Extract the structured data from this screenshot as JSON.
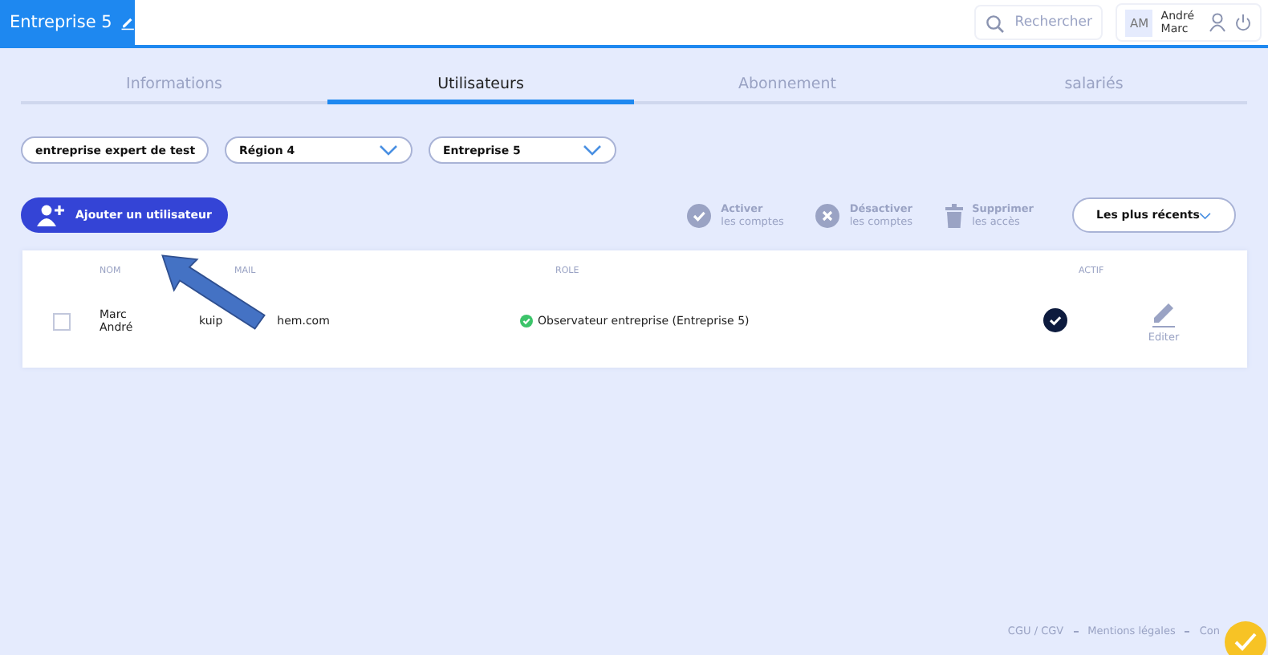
{
  "header": {
    "title": "Entreprise 5",
    "search": {
      "placeholder": "Rechercher"
    },
    "user": {
      "initials": "AM",
      "first_name": "André",
      "last_name": "Marc"
    }
  },
  "tabs": [
    {
      "label": "Informations",
      "selected": false
    },
    {
      "label": "Utilisateurs",
      "selected": true
    },
    {
      "label": "Abonnement",
      "selected": false
    },
    {
      "label": "salariés",
      "selected": false
    }
  ],
  "filters": [
    "entreprise expert de test",
    "Région 4",
    "Entreprise 5"
  ],
  "toolbar": {
    "add_button": "Ajouter un utilisateur",
    "actions": [
      {
        "kind": "check",
        "title": "Activer",
        "subtitle": "les comptes"
      },
      {
        "kind": "cross",
        "title": "Désactiver",
        "subtitle": "les comptes"
      },
      {
        "kind": "trash",
        "title": "Supprimer",
        "subtitle": "les accès"
      }
    ],
    "sort": "Les plus récents"
  },
  "table": {
    "columns": [
      "NOM",
      "MAIL",
      "ROLE",
      "ACTIF"
    ],
    "rows": [
      {
        "checked": false,
        "name_lines": [
          "Marc",
          "André"
        ],
        "email_parts": [
          "kuip",
          "hem.com"
        ],
        "role": "Observateur entreprise (Entreprise 5)",
        "active": true,
        "edit": "Editer"
      }
    ]
  },
  "footer": [
    "CGU / CGV",
    "Mentions légales",
    "Con"
  ]
}
